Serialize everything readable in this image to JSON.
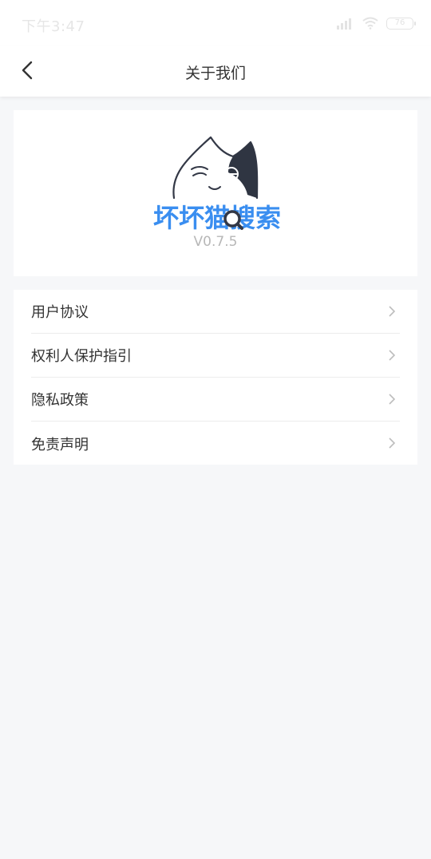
{
  "status_bar": {
    "time": "下午3:47",
    "battery": "76"
  },
  "nav": {
    "title": "关于我们"
  },
  "app": {
    "logo_text": "坏坏猫搜索",
    "version": "V0.7.5"
  },
  "menu": [
    {
      "label": "用户协议"
    },
    {
      "label": "权利人保护指引"
    },
    {
      "label": "隐私政策"
    },
    {
      "label": "免责声明"
    }
  ],
  "colors": {
    "brand_blue": "#3a8ef0",
    "background": "#f6f7f9",
    "card": "#ffffff",
    "text": "#333333",
    "muted": "#b7b7b7"
  }
}
